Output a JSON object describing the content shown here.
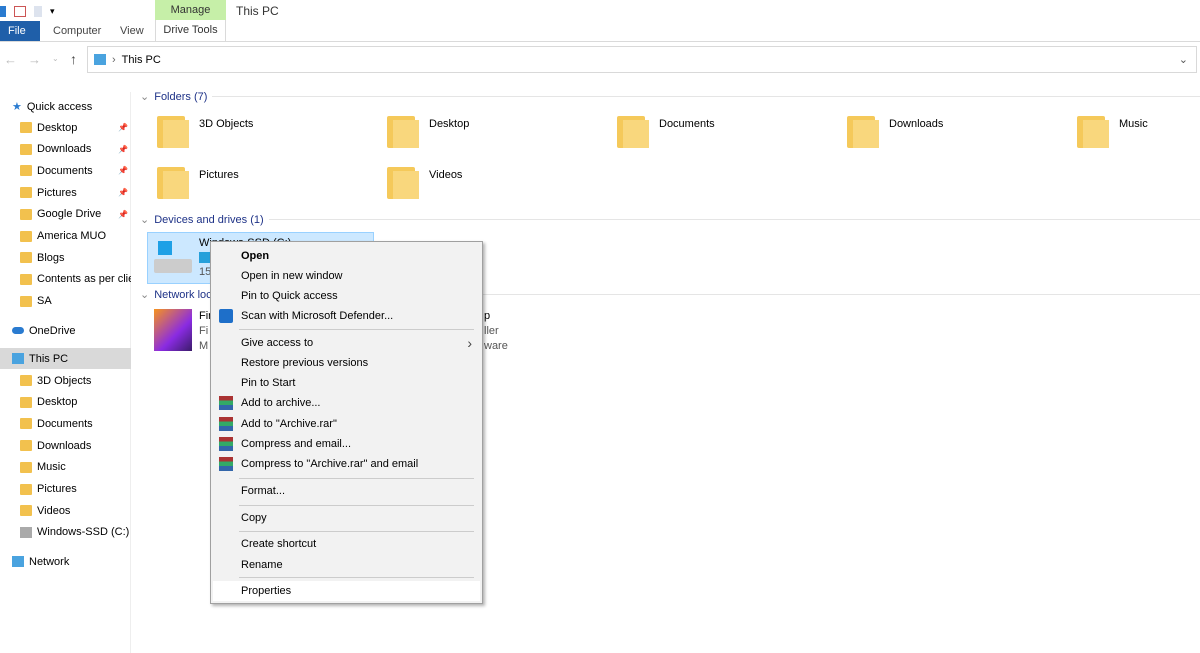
{
  "window": {
    "title": "This PC"
  },
  "ribbon": {
    "contextual_group": "Manage",
    "tabs": [
      "File",
      "Computer",
      "View",
      "Drive Tools"
    ]
  },
  "address": {
    "path": "This PC"
  },
  "sidebar": {
    "quick_access": "Quick access",
    "quick_items": [
      {
        "label": "Desktop",
        "pinned": true
      },
      {
        "label": "Downloads",
        "pinned": true
      },
      {
        "label": "Documents",
        "pinned": true
      },
      {
        "label": "Pictures",
        "pinned": true
      },
      {
        "label": "Google Drive",
        "pinned": true
      },
      {
        "label": "America MUO"
      },
      {
        "label": "Blogs"
      },
      {
        "label": "Contents as per clie"
      },
      {
        "label": "SA"
      }
    ],
    "onedrive": "OneDrive",
    "this_pc": "This PC",
    "pc_items": [
      "3D Objects",
      "Desktop",
      "Documents",
      "Downloads",
      "Music",
      "Pictures",
      "Videos",
      "Windows-SSD (C:)"
    ],
    "network": "Network"
  },
  "main": {
    "folders_header": "Folders (7)",
    "folders": [
      "3D Objects",
      "Desktop",
      "Documents",
      "Downloads",
      "Music",
      "Pictures",
      "Videos"
    ],
    "devices_header": "Devices and drives (1)",
    "drive": {
      "name_visible": "Windows-SSD (C:)",
      "size_fragment": "15",
      "fill_percent": 60
    },
    "network_header_fragment": "Network loc",
    "network_item_fragments": [
      "Fir",
      "Fi",
      "M"
    ],
    "network_item2_fragments": [
      "p",
      "ller",
      "ware"
    ]
  },
  "context_menu": {
    "items": [
      "Open",
      "Open in new window",
      "Pin to Quick access",
      "Scan with Microsoft Defender...",
      "Give access to",
      "Restore previous versions",
      "Pin to Start",
      "Add to archive...",
      "Add to \"Archive.rar\"",
      "Compress and email...",
      "Compress to \"Archive.rar\" and email",
      "Format...",
      "Copy",
      "Create shortcut",
      "Rename",
      "Properties"
    ]
  },
  "colors": {
    "file_tab": "#1f5fa9",
    "manage_tab": "#c6efa8",
    "selection": "#cce8ff",
    "group_header": "#1e3287"
  }
}
